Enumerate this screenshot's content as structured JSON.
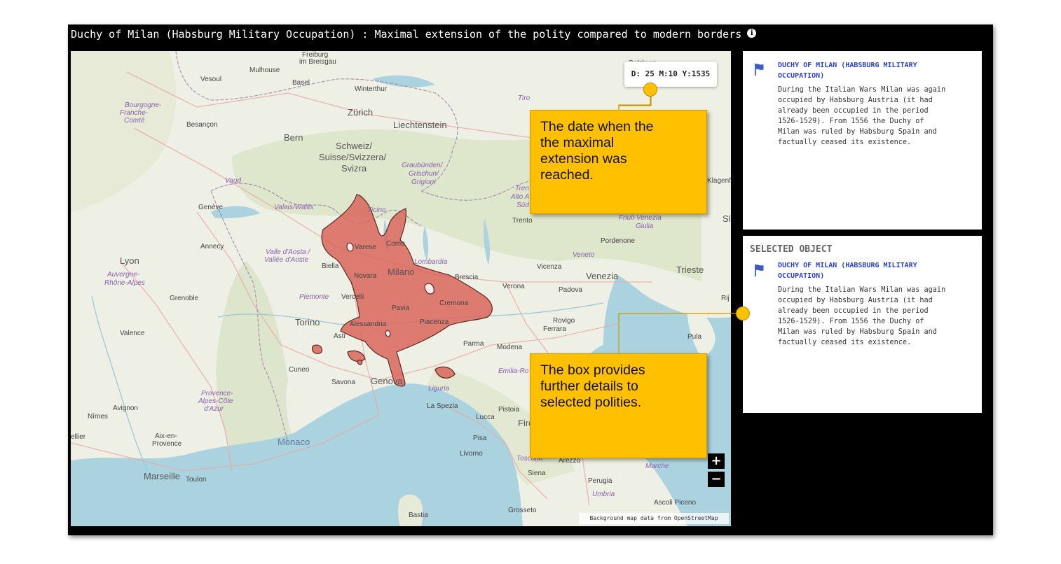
{
  "header": {
    "title": "Duchy of Milan (Habsburg Military Occupation) : Maximal extension of the polity compared to modern borders",
    "info_icon": "info-icon"
  },
  "map": {
    "date_label": "D: 25 M:10 Y:1535",
    "zoom_in": "+",
    "zoom_out": "−",
    "attribution": "Background map data from OpenStreetMap",
    "labels": {
      "freiburg": "Freiburg",
      "breisgau": "im Breisgau",
      "mulhouse": "Mulhouse",
      "vesoul": "Vesoul",
      "basel": "Basel",
      "winterthur": "Winterthur",
      "bourgogne": "Bourgogne-",
      "franche": "Franche-",
      "comte": "Comté",
      "zurich": "Zürich",
      "liechtenstein": "Liechtenstein",
      "besancon": "Besançon",
      "bern": "Bern",
      "schweiz": "Schweiz/",
      "suisse": "Suisse/Svizzera/",
      "svizra": "Svizra",
      "graubunden": "Graubünden/",
      "grischun": "Grischun/",
      "grigioni": "Grigioni",
      "vaud": "Vaud",
      "geneve": "Genève",
      "valais": "Valais/Wallis",
      "ticino": "Ticino",
      "annecy": "Annecy",
      "varese": "Varese",
      "como": "Como",
      "valle_aosta": "Valle d'Aosta /",
      "vallee_aoste": "Vallée d'Aoste",
      "lyon": "Lyon",
      "biella": "Biella",
      "milano": "Milano",
      "lombardia": "Lombardia",
      "auvergne": "Auvergne-",
      "rhone_alpes": "Rhône-Alpes",
      "novara": "Novara",
      "brescia": "Brescia",
      "vercelli": "Vercelli",
      "piemonte": "Piemonte",
      "grenoble": "Grenoble",
      "pavia": "Pavia",
      "cremona": "Cremona",
      "torino": "Torino",
      "alessandria": "Alessandria",
      "piacenza": "Piacenza",
      "valence": "Valence",
      "asti": "Asti",
      "parma": "Parma",
      "modena": "Modena",
      "cuneo": "Cuneo",
      "genova": "Genova",
      "savona": "Savona",
      "emilia": "Emilia-Ro",
      "provence": "Provence-",
      "alpes_cote": "Alpes-Côte",
      "azur": "d'Azur",
      "liguria": "Liguria",
      "avignon": "Avignon",
      "la_spezia": "La Spezia",
      "nimes": "Nîmes",
      "pistoia": "Pistoia",
      "lucca": "Lucca",
      "aix": "Aix-en-",
      "provence_city": "Provence",
      "pisa": "Pisa",
      "montpellier": "ellier",
      "monaco": "Monaco",
      "livorno": "Livorno",
      "toscana": "Toscana",
      "arezzo": "Arezzo",
      "marche": "Marche",
      "siena": "Siena",
      "perugia": "Perugia",
      "marseille": "Marseille",
      "toulon": "Toulon",
      "umbria": "Umbria",
      "ascoli": "Ascoli Piceno",
      "bastia": "Bastia",
      "grosseto": "Grosseto",
      "trento": "Trento",
      "alto_adige": "Alto A",
      "sud": "Süd",
      "tren": "Tren",
      "tiro": "Tiro",
      "friuli": "Friuli-Venezia",
      "giulia": "Giulia",
      "pordenone": "Pordenone",
      "veneto": "Veneto",
      "vicenza": "Vicenza",
      "venezia": "Venezia",
      "trieste": "Trieste",
      "verona": "Verona",
      "padova": "Padova",
      "rovigo": "Rovigo",
      "ferrara": "Ferrara",
      "pula": "Pula",
      "fire": "Fire",
      "salzburg": "Salzburg",
      "klagenf": "Klagenf",
      "sl": "Sl",
      "rij": "Rij"
    }
  },
  "details_panel": {
    "polity_name_line1": "DUCHY OF MILAN (HABSBURG MILITARY",
    "polity_name_line2": "OCCUPATION)",
    "desc_lines": [
      "During the Italian Wars Milan was again",
      "occupied by Habsburg Austria (it had",
      "already been occupied in the period",
      "1526-1529). From 1556 the Duchy of",
      "Milan was ruled by Habsburg Spain and",
      "factually ceased its existence."
    ]
  },
  "selected_panel": {
    "heading": "SELECTED OBJECT",
    "polity_name_line1": "DUCHY OF MILAN (HABSBURG MILITARY",
    "polity_name_line2": "OCCUPATION)",
    "desc_lines": [
      "During the Italian Wars Milan was again",
      "occupied by Habsburg Austria (it had",
      "already been occupied in the period",
      "1526-1529). From 1556 the Duchy of",
      "Milan was ruled by Habsburg Spain and",
      "factually ceased its existence."
    ]
  },
  "callouts": {
    "date_callout": [
      "The date when the",
      "the maximal",
      "extension was",
      "reached."
    ],
    "box_callout": [
      "The box provides",
      "further details to",
      "selected polities."
    ]
  },
  "colors": {
    "polity_fill": "#d9665c",
    "callout": "#ffc000",
    "sea": "#aad3df",
    "land": "#eef0e5",
    "link": "#2a3fd6"
  }
}
